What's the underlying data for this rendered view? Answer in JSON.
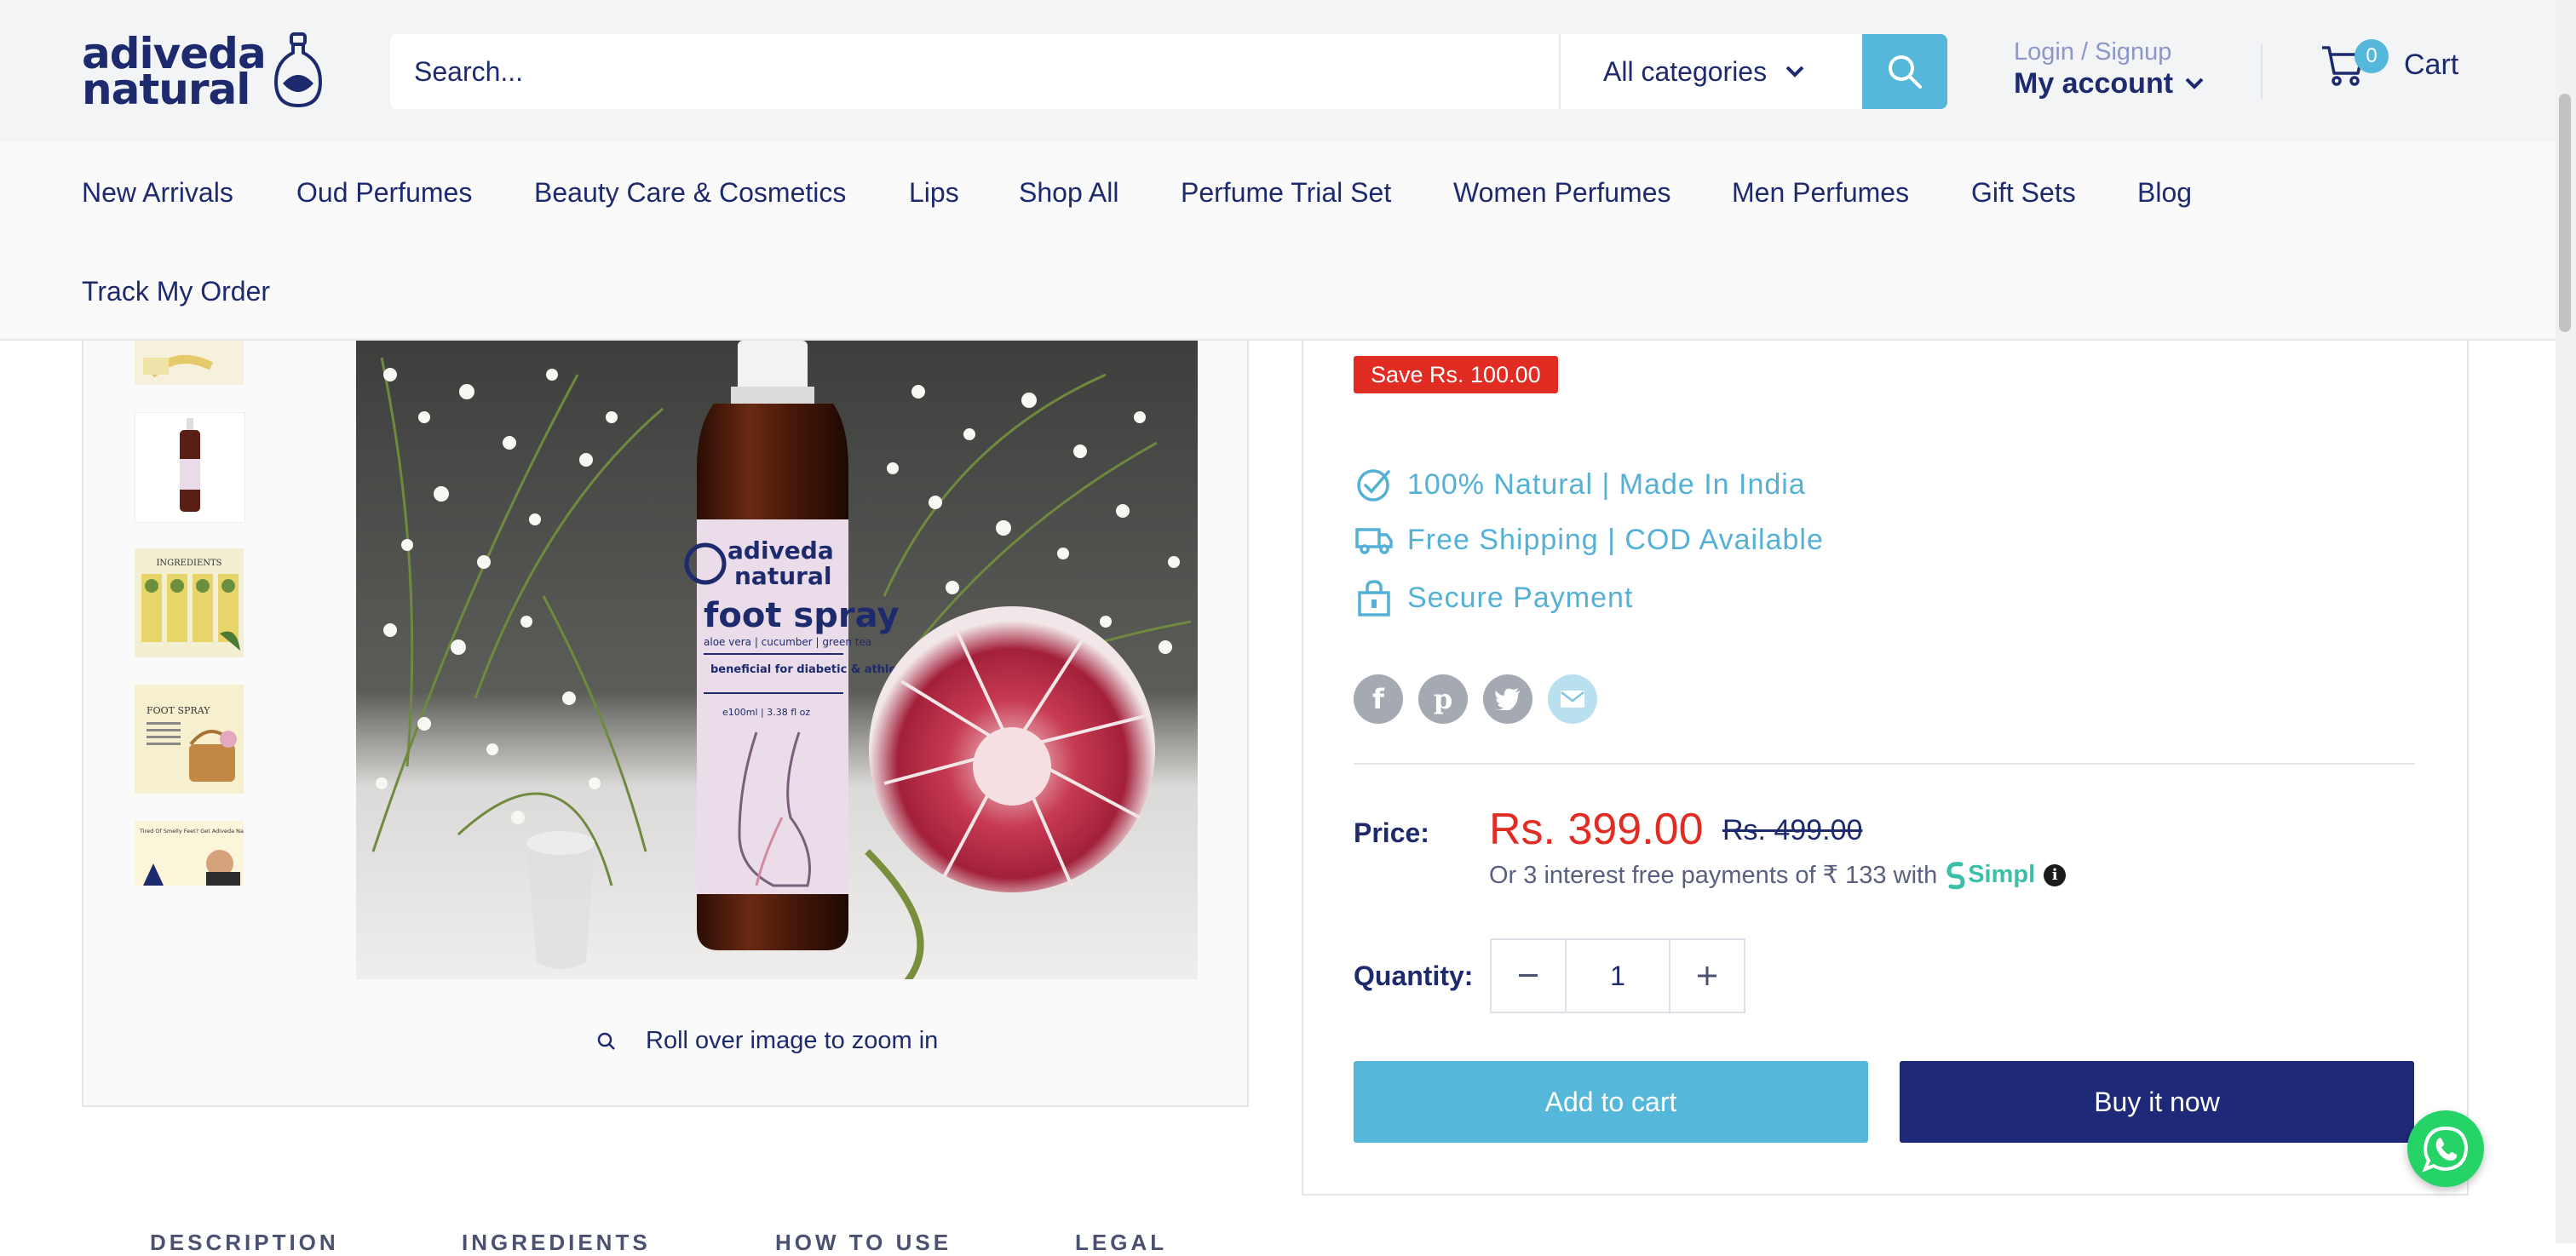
{
  "brand": {
    "line1": "adiveda",
    "line2": "natural"
  },
  "search": {
    "placeholder": "Search...",
    "category": "All categories"
  },
  "account": {
    "login_text": "Login / Signup",
    "label": "My account"
  },
  "cart": {
    "count": "0",
    "label": "Cart"
  },
  "nav": {
    "items": [
      "New Arrivals",
      "Oud Perfumes",
      "Beauty Care & Cosmetics",
      "Lips",
      "Shop All",
      "Perfume Trial Set",
      "Women Perfumes",
      "Men Perfumes",
      "Gift Sets",
      "Blog",
      "Track My Order"
    ]
  },
  "gallery": {
    "zoom_hint": "Roll over image to zoom in",
    "product_label": {
      "brand_line1": "adiveda",
      "brand_line2": "natural",
      "name": "foot spray",
      "ingredients": "aloe vera | cucumber | green tea",
      "benefit": "beneficial for diabetic & athlete's foot",
      "volume": "e100ml | 3.38 fl oz"
    },
    "thumb_ingredients_title": "INGREDIENTS",
    "thumb_foot_spray_title": "FOOT SPRAY",
    "thumb_last_text": "Tired Of Smelly Feet? Get Adiveda Natural Foot Spray!"
  },
  "product": {
    "save_badge": "Save Rs. 100.00",
    "features": [
      "100% Natural | Made In India",
      "Free Shipping | COD Available",
      "Secure Payment"
    ],
    "price_label": "Price:",
    "price": "Rs. 399.00",
    "compare_price": "Rs. 499.00",
    "emi_text": "Or 3 interest free payments of ₹ 133 with",
    "emi_brand": "Simpl",
    "quantity_label": "Quantity:",
    "quantity": "1",
    "add_to_cart": "Add to cart",
    "buy_now": "Buy it now"
  },
  "tabs": [
    "DESCRIPTION",
    "INGREDIENTS",
    "HOW TO USE",
    "LEGAL"
  ],
  "colors": {
    "brand_navy": "#1e2a6e",
    "accent_blue": "#55b8db",
    "sale_red": "#e02c22",
    "feature_blue": "#55b0d6",
    "whatsapp_green": "#25d366"
  },
  "icons": [
    "search-icon",
    "chevron-down-icon",
    "cart-icon",
    "check-badge-icon",
    "truck-icon",
    "lock-bag-icon",
    "facebook-icon",
    "pinterest-icon",
    "twitter-icon",
    "email-icon",
    "zoom-icon",
    "whatsapp-icon",
    "info-icon"
  ]
}
